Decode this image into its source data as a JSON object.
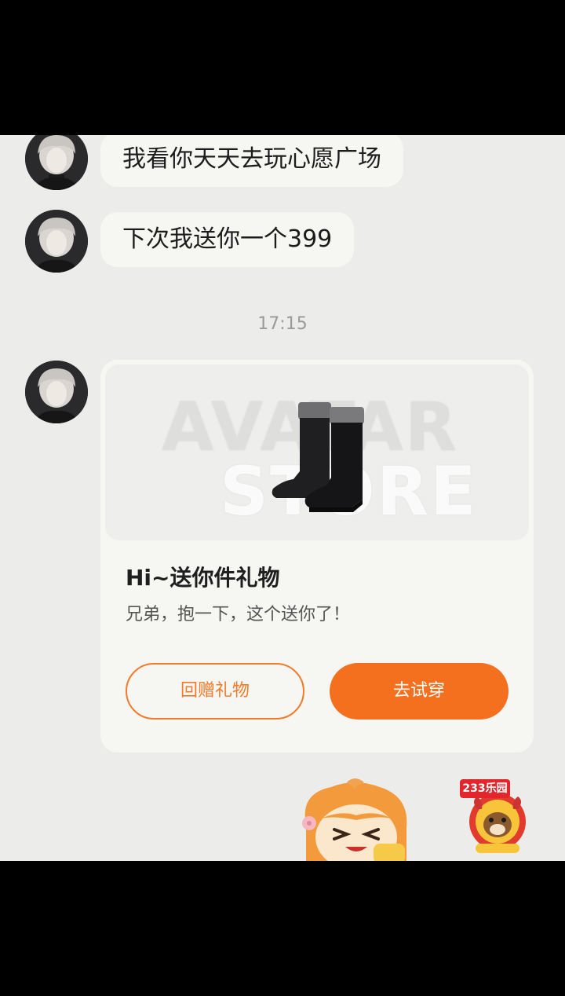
{
  "messages": [
    {
      "text": "我看你天天去玩心愿广场"
    },
    {
      "text": "下次我送你一个399"
    }
  ],
  "timestamp": "17:15",
  "gift_card": {
    "watermark_line1": "AVATAR",
    "watermark_line2": "STORE",
    "title": "Hi~送你件礼物",
    "description": "兄弟，抱一下，这个送你了！",
    "return_gift_label": "回赠礼物",
    "try_on_label": "去试穿"
  },
  "logo": {
    "text": "233乐园"
  },
  "icons": [
    "avatar",
    "boots-image",
    "mascot-icon",
    "233-logo-icon"
  ],
  "colors": {
    "accent": "#f4701f",
    "background": "#ecedea",
    "bubble": "#f6f6f3"
  }
}
